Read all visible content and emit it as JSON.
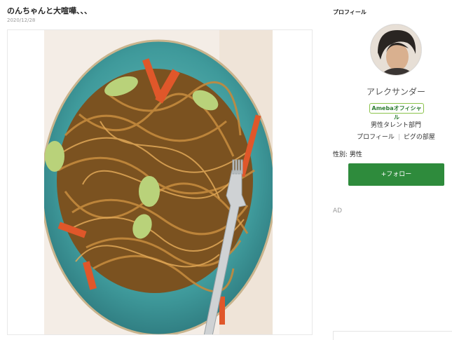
{
  "post": {
    "title": "のんちゃんと大喧嘩、、、",
    "date": "2020/12/28"
  },
  "sidebar": {
    "heading": "プロフィール",
    "name": "アレクサンダー",
    "badge": "Amebaオフィシャル",
    "category": "男性タレント部門",
    "links": [
      "プロフィール",
      "ピグの部屋"
    ],
    "gender": "性別: 男性",
    "follow_label": "+フォロー",
    "ad_label": "AD"
  },
  "colors": {
    "follow_green": "#2e8b3c",
    "plate_teal": "#3f9a9b",
    "badge_green": "#2e7d32"
  }
}
